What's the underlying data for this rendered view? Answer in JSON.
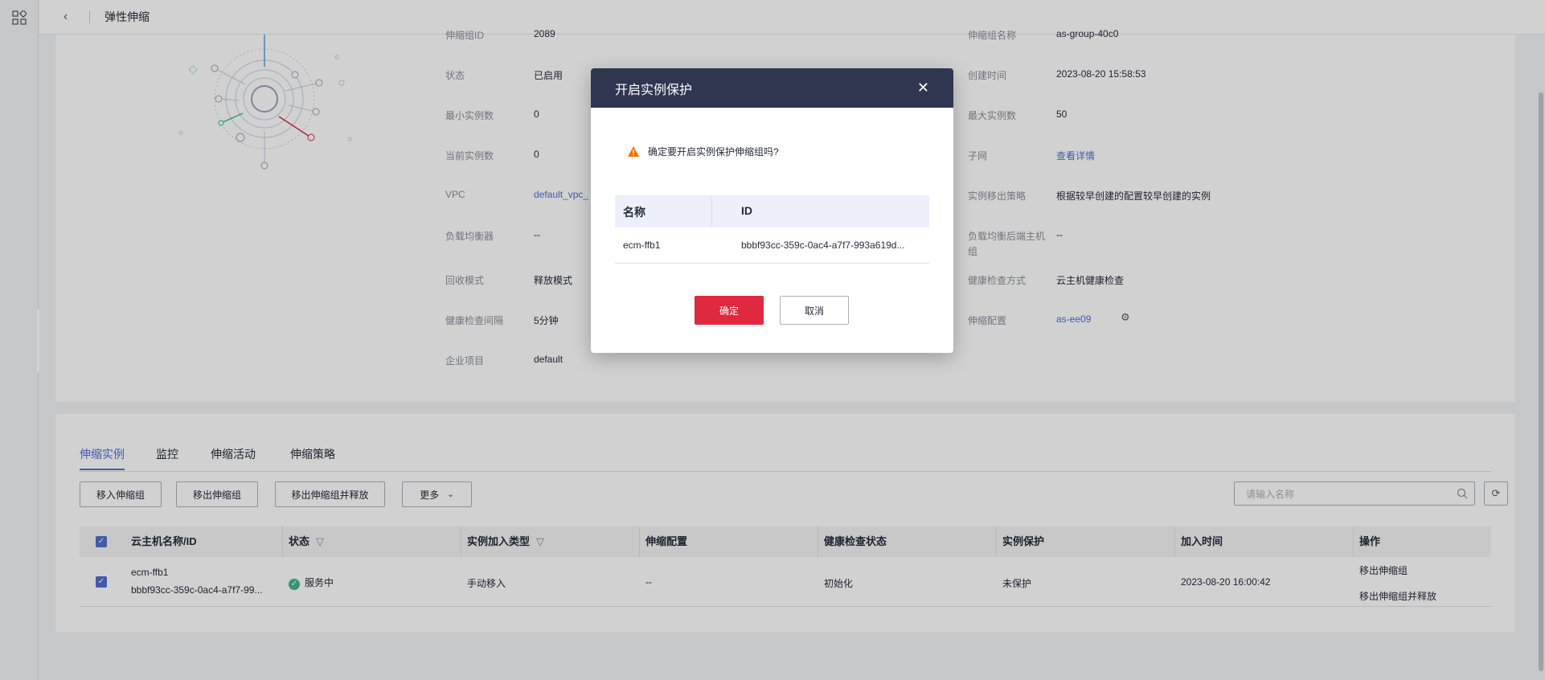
{
  "topbar": {
    "title": "弹性伸缩"
  },
  "info": {
    "rows": [
      {
        "l_label": "伸缩组ID",
        "l_value": "2089",
        "r_label": "伸缩组名称",
        "r_value": "as-group-40c0"
      },
      {
        "l_label": "状态",
        "l_value": "已启用",
        "r_label": "创建时间",
        "r_value": "2023-08-20 15:58:53"
      },
      {
        "l_label": "最小实例数",
        "l_value": "0",
        "r_label": "最大实例数",
        "r_value": "50"
      },
      {
        "l_label": "当前实例数",
        "l_value": "0",
        "r_label": "子网",
        "r_value": "查看详情"
      },
      {
        "l_label": "VPC",
        "l_value": "default_vpc_",
        "r_label": "实例移出策略",
        "r_value": "根据较早创建的配置较早创建的实例"
      },
      {
        "l_label": "负载均衡器",
        "l_value": "--",
        "r_label": "负载均衡后端主机组",
        "r_value": "--"
      },
      {
        "l_label": "回收模式",
        "l_value": "释放模式",
        "r_label": "健康检查方式",
        "r_value": "云主机健康检查"
      },
      {
        "l_label": "健康检查间隔",
        "l_value": "5分钟",
        "r_label": "伸缩配置",
        "r_value": "as-ee09"
      },
      {
        "l_label": "企业项目",
        "l_value": "default"
      }
    ]
  },
  "tabs": [
    "伸缩实例",
    "监控",
    "伸缩活动",
    "伸缩策略"
  ],
  "toolbar": {
    "move_in": "移入伸缩组",
    "move_out": "移出伸缩组",
    "move_out_release": "移出伸缩组并释放",
    "more": "更多",
    "search_placeholder": "请输入名称"
  },
  "table": {
    "headers": [
      "云主机名称/ID",
      "状态",
      "实例加入类型",
      "伸缩配置",
      "健康检查状态",
      "实例保护",
      "加入时间",
      "操作"
    ],
    "rows": [
      {
        "name": "ecm-ffb1",
        "id": "bbbf93cc-359c-0ac4-a7f7-99...",
        "status": "服务中",
        "join_type": "手动移入",
        "config": "--",
        "health": "初始化",
        "protect": "未保护",
        "join_time": "2023-08-20 16:00:42",
        "action1": "移出伸缩组",
        "action2": "移出伸缩组并释放"
      }
    ]
  },
  "dialog": {
    "title": "开启实例保护",
    "message": "确定要开启实例保护伸缩组吗?",
    "col_name": "名称",
    "col_id": "ID",
    "row_name": "ecm-ffb1",
    "row_id": "bbbf93cc-359c-0ac4-a7f7-993a619d...",
    "ok": "确定",
    "cancel": "取消"
  }
}
